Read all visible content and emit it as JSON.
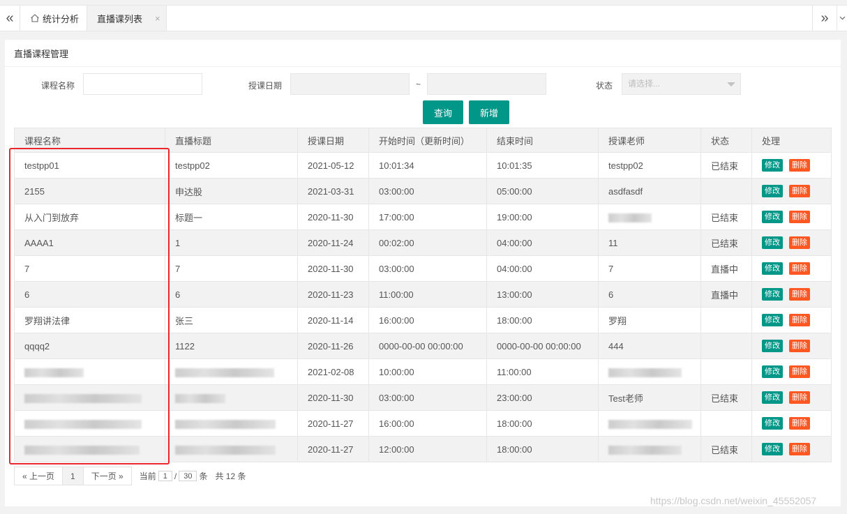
{
  "tabs": {
    "left_nav": "«",
    "right_nav": "»",
    "items": [
      {
        "label": "统计分析",
        "icon": "home-icon"
      },
      {
        "label": "直播课列表",
        "close": "×"
      }
    ]
  },
  "panel": {
    "title": "直播课程管理"
  },
  "filters": {
    "course_name_label": "课程名称",
    "course_name_value": "",
    "date_label": "授课日期",
    "date_start": "",
    "date_sep": "~",
    "date_end": "",
    "status_label": "状态",
    "status_placeholder": "请选择..."
  },
  "buttons": {
    "query": "查询",
    "add": "新增"
  },
  "table": {
    "columns": [
      "课程名称",
      "直播标题",
      "授课日期",
      "开始时间（更新时间）",
      "结束时间",
      "授课老师",
      "状态",
      "处理"
    ],
    "edit_label": "修改",
    "delete_label": "删除",
    "rows": [
      {
        "name": "testpp01",
        "title": "testpp02",
        "date": "2021-05-12",
        "start": "10:01:34",
        "end": "10:01:35",
        "teacher": "testpp02",
        "status": "已结束"
      },
      {
        "name": "2155",
        "title": "申达股",
        "date": "2021-03-31",
        "start": "03:00:00",
        "end": "05:00:00",
        "teacher": "asdfasdf",
        "status": ""
      },
      {
        "name": "从入门到放弃",
        "title": "标题一",
        "date": "2020-11-30",
        "start": "17:00:00",
        "end": "19:00:00",
        "teacher": "",
        "status": "已结束"
      },
      {
        "name": "AAAA1",
        "title": "1",
        "date": "2020-11-24",
        "start": "00:02:00",
        "end": "04:00:00",
        "teacher": "11",
        "status": "已结束"
      },
      {
        "name": "7",
        "title": "7",
        "date": "2020-11-30",
        "start": "03:00:00",
        "end": "04:00:00",
        "teacher": "7",
        "status": "直播中"
      },
      {
        "name": "6",
        "title": "6",
        "date": "2020-11-23",
        "start": "11:00:00",
        "end": "13:00:00",
        "teacher": "6",
        "status": "直播中"
      },
      {
        "name": "罗翔讲法律",
        "title": "张三",
        "date": "2020-11-14",
        "start": "16:00:00",
        "end": "18:00:00",
        "teacher": "罗翔",
        "status": ""
      },
      {
        "name": "qqqq2",
        "title": "1122",
        "date": "2020-11-26",
        "start": "0000-00-00 00:00:00",
        "end": "0000-00-00 00:00:00",
        "teacher": "444",
        "status": ""
      },
      {
        "name": "",
        "title": "",
        "date": "2021-02-08",
        "start": "10:00:00",
        "end": "11:00:00",
        "teacher": "",
        "status": ""
      },
      {
        "name": "",
        "title": "",
        "date": "2020-11-30",
        "start": "03:00:00",
        "end": "23:00:00",
        "teacher": "Test老师",
        "status": "已结束"
      },
      {
        "name": "",
        "title": "",
        "date": "2020-11-27",
        "start": "16:00:00",
        "end": "18:00:00",
        "teacher": "",
        "status": ""
      },
      {
        "name": "",
        "title": "",
        "date": "2020-11-27",
        "start": "12:00:00",
        "end": "18:00:00",
        "teacher": "",
        "status": "已结束"
      }
    ]
  },
  "pagination": {
    "prev": "« 上一页",
    "current": "1",
    "next": "下一页 »",
    "goto_label": "当前",
    "goto_value": "1",
    "slash": "/",
    "per_page": "30",
    "per_page_unit": "条",
    "total": "共 12 条"
  },
  "watermark": "https://blog.csdn.net/weixin_45552057",
  "colors": {
    "primary": "#009688",
    "danger": "#ff5722",
    "annotation": "#e8262b"
  }
}
